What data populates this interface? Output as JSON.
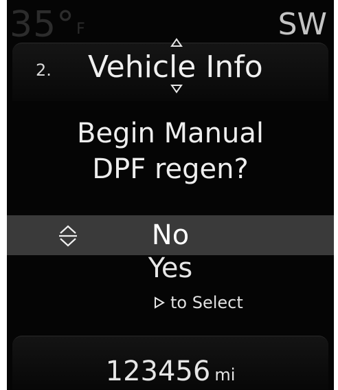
{
  "status_bar": {
    "temperature": "35°",
    "temperature_unit": "F",
    "compass_heading": "SW"
  },
  "menu": {
    "number": "2.",
    "title": "Vehicle Info"
  },
  "prompt": {
    "line1": "Begin Manual",
    "line2": "DPF regen?"
  },
  "options": {
    "selected": "No",
    "items": [
      "No",
      "Yes"
    ]
  },
  "hint": {
    "text": "to Select"
  },
  "odometer": {
    "value": "123456",
    "unit": "mi"
  },
  "icons": {
    "up": "chevron-up-icon",
    "down": "chevron-down-icon",
    "updown": "up-down-arrows-icon",
    "select": "play-triangle-icon"
  },
  "colors": {
    "background": "#050505",
    "text": "#eeeeee",
    "selection_band": "#3a3a3a"
  }
}
